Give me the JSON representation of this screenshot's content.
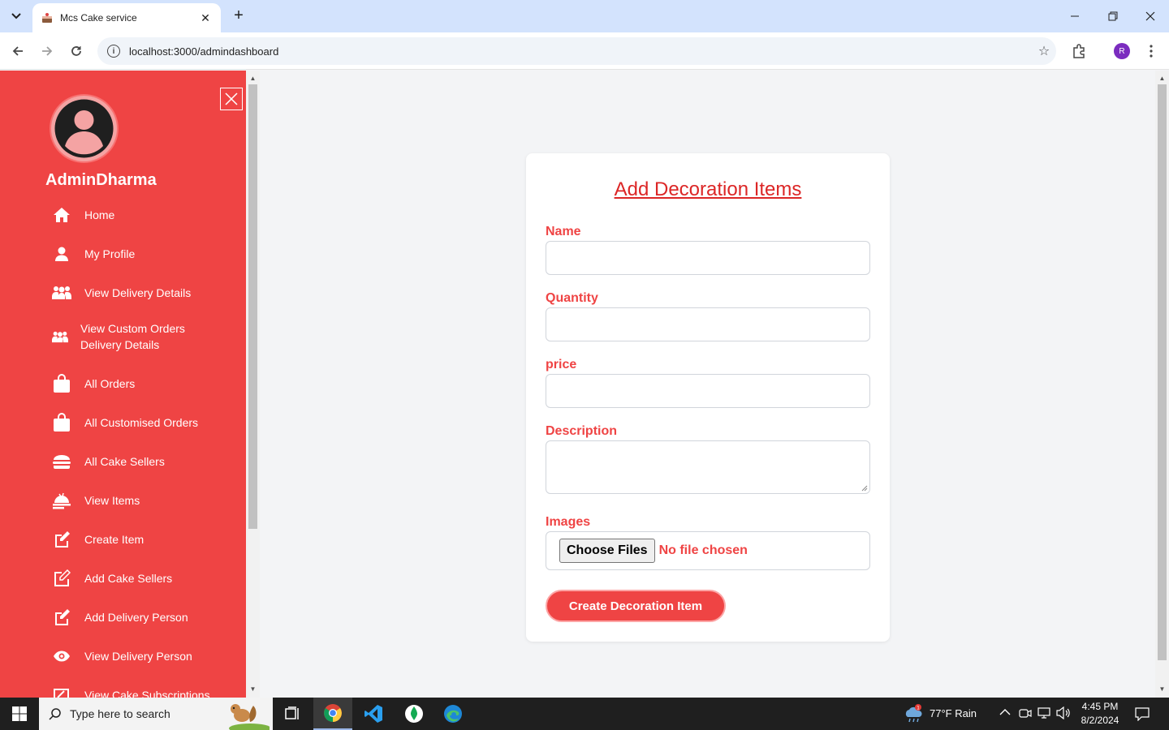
{
  "browser": {
    "tab_title": "Mcs Cake service",
    "url": "localhost:3000/admindashboard",
    "profile_initial": "R"
  },
  "sidebar": {
    "admin_name": "AdminDharma",
    "items": [
      {
        "label": "Home",
        "icon": "home-icon"
      },
      {
        "label": "My Profile",
        "icon": "user-icon"
      },
      {
        "label": "View Delivery Details",
        "icon": "users-icon"
      },
      {
        "label": "View Custom Orders Delivery Details",
        "icon": "users-icon"
      },
      {
        "label": "All Orders",
        "icon": "shopping-bag-icon"
      },
      {
        "label": "All Customised Orders",
        "icon": "shopping-bag-icon"
      },
      {
        "label": "All Cake Sellers",
        "icon": "burger-icon"
      },
      {
        "label": "View Items",
        "icon": "food-tray-icon"
      },
      {
        "label": "Create Item",
        "icon": "edit-icon"
      },
      {
        "label": "Add Cake Sellers",
        "icon": "edit-outline-icon"
      },
      {
        "label": "Add Delivery Person",
        "icon": "edit-icon"
      },
      {
        "label": "View Delivery Person",
        "icon": "eye-icon"
      },
      {
        "label": "View Cake Subscriptions",
        "icon": "edit-square-icon"
      }
    ]
  },
  "form": {
    "title": "Add Decoration Items",
    "name_label": "Name",
    "quantity_label": "Quantity",
    "price_label": "price",
    "description_label": "Description",
    "images_label": "Images",
    "choose_files_label": "Choose Files",
    "no_file_text": "No file chosen",
    "submit_label": "Create Decoration Item",
    "name_value": "",
    "quantity_value": "",
    "price_value": "",
    "description_value": ""
  },
  "taskbar": {
    "search_placeholder": "Type here to search",
    "weather": "77°F  Rain",
    "weather_badge": "1",
    "time": "4:45 PM",
    "date": "8/2/2024"
  },
  "colors": {
    "sidebar": "#ef4444",
    "accent": "#dc2626",
    "label": "#ef4444"
  }
}
